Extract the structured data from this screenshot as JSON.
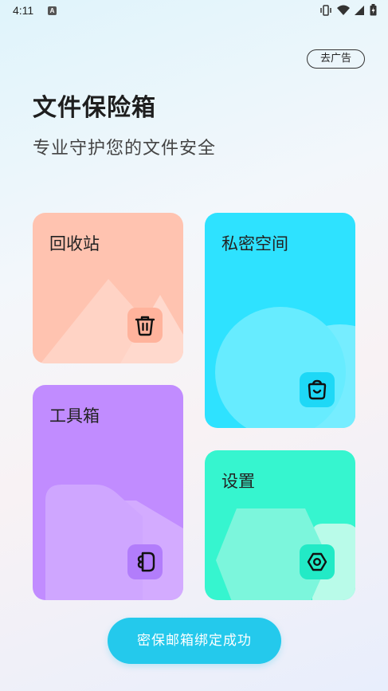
{
  "status_bar": {
    "time": "4:11",
    "notification_badge": "A"
  },
  "header": {
    "ad_button": "去广告",
    "title": "文件保险箱",
    "subtitle": "专业守护您的文件安全"
  },
  "cards": {
    "recycle": {
      "label": "回收站",
      "color": "#ffc3b0",
      "icon": "trash-icon"
    },
    "private": {
      "label": "私密空间",
      "color": "#2ee2ff",
      "icon": "bag-icon"
    },
    "tools": {
      "label": "工具箱",
      "color": "#c18cff",
      "icon": "toolbox-icon"
    },
    "settings": {
      "label": "设置",
      "color": "#36f5cf",
      "icon": "gear-icon"
    }
  },
  "bottom_button": {
    "label": "密保邮箱绑定成功",
    "color": "#24c9ec"
  }
}
